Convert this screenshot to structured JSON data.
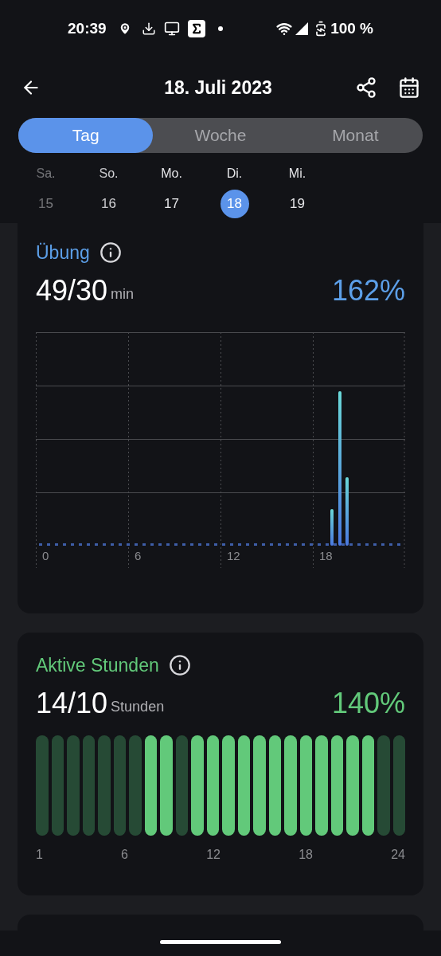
{
  "status_bar": {
    "time": "20:39",
    "battery": "100 %"
  },
  "header": {
    "title": "18. Juli 2023"
  },
  "tabs": [
    {
      "label": "Tag",
      "selected": true
    },
    {
      "label": "Woche",
      "selected": false
    },
    {
      "label": "Monat",
      "selected": false
    }
  ],
  "week": [
    {
      "day": "Sa.",
      "date": "15",
      "selected": false
    },
    {
      "day": "So.",
      "date": "16",
      "selected": false
    },
    {
      "day": "Mo.",
      "date": "17",
      "selected": false
    },
    {
      "day": "Di.",
      "date": "18",
      "selected": true
    },
    {
      "day": "Mi.",
      "date": "19",
      "selected": false
    }
  ],
  "exercise": {
    "title": "Übung",
    "value": "49/30",
    "unit": "min",
    "percent": "162%",
    "x_labels": [
      "0",
      "6",
      "12",
      "18"
    ]
  },
  "active_hours": {
    "title": "Aktive Stunden",
    "value": "14/10",
    "unit": "Stunden",
    "percent": "140%",
    "hours": [
      {
        "active": false
      },
      {
        "active": false
      },
      {
        "active": false
      },
      {
        "active": false
      },
      {
        "active": false
      },
      {
        "active": false
      },
      {
        "active": false
      },
      {
        "active": true
      },
      {
        "active": true
      },
      {
        "active": false
      },
      {
        "active": true
      },
      {
        "active": true
      },
      {
        "active": true
      },
      {
        "active": true
      },
      {
        "active": true
      },
      {
        "active": true
      },
      {
        "active": true
      },
      {
        "active": true
      },
      {
        "active": true
      },
      {
        "active": true
      },
      {
        "active": true
      },
      {
        "active": true
      },
      {
        "active": false
      },
      {
        "active": false
      }
    ],
    "x_labels": [
      "1",
      "6",
      "12",
      "18",
      "24"
    ]
  }
}
